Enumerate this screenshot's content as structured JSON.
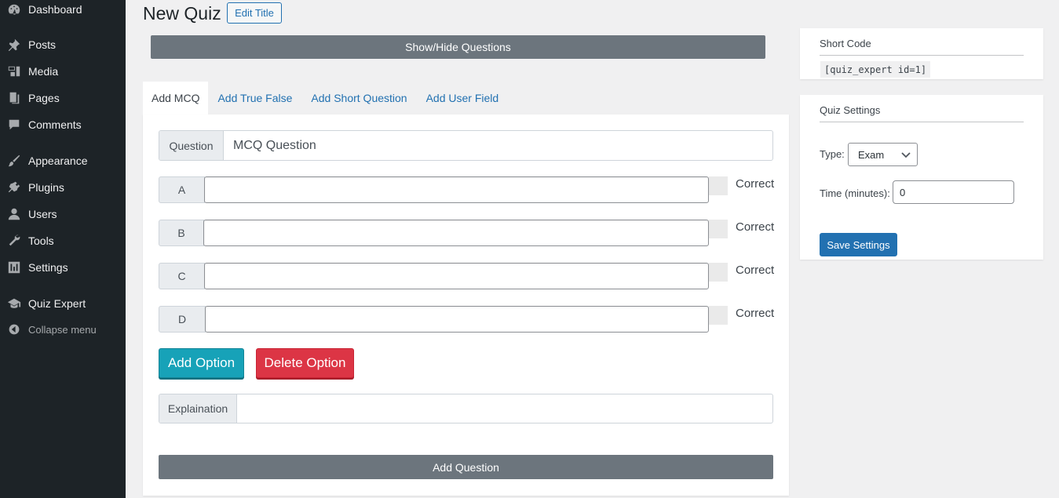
{
  "sidebar": {
    "items": [
      {
        "label": "Dashboard",
        "icon": "dashboard-icon"
      },
      {
        "label": "Posts",
        "icon": "pin-icon"
      },
      {
        "label": "Media",
        "icon": "media-icon"
      },
      {
        "label": "Pages",
        "icon": "pages-icon"
      },
      {
        "label": "Comments",
        "icon": "comment-icon"
      },
      {
        "label": "Appearance",
        "icon": "brush-icon"
      },
      {
        "label": "Plugins",
        "icon": "plugin-icon"
      },
      {
        "label": "Users",
        "icon": "user-icon"
      },
      {
        "label": "Tools",
        "icon": "wrench-icon"
      },
      {
        "label": "Settings",
        "icon": "sliders-icon"
      },
      {
        "label": "Quiz Expert",
        "icon": "graduation-cap-icon"
      }
    ],
    "collapse_label": "Collapse menu"
  },
  "header": {
    "title": "New Quiz",
    "edit_title_label": "Edit Title"
  },
  "show_hide_label": "Show/Hide Questions",
  "tabs": [
    {
      "label": "Add MCQ",
      "active": true
    },
    {
      "label": "Add True False",
      "active": false
    },
    {
      "label": "Add Short Question",
      "active": false
    },
    {
      "label": "Add User Field",
      "active": false
    }
  ],
  "form": {
    "question_label": "Question",
    "question_value": "MCQ Question",
    "options": [
      {
        "letter": "A",
        "value": "",
        "correct_label": "Correct"
      },
      {
        "letter": "B",
        "value": "",
        "correct_label": "Correct"
      },
      {
        "letter": "C",
        "value": "",
        "correct_label": "Correct"
      },
      {
        "letter": "D",
        "value": "",
        "correct_label": "Correct"
      }
    ],
    "add_option_label": "Add Option",
    "delete_option_label": "Delete Option",
    "explanation_label": "Explaination",
    "explanation_value": "",
    "add_question_label": "Add Question"
  },
  "shortcode_box": {
    "title": "Short Code",
    "code": "[quiz_expert id=1]"
  },
  "settings_box": {
    "title": "Quiz Settings",
    "type_label": "Type:",
    "type_value": "Exam",
    "time_label": "Time (minutes):",
    "time_value": "0",
    "save_label": "Save Settings"
  },
  "colors": {
    "sidebar_bg": "#1d2327",
    "link": "#2271b1",
    "add_option": "#17a2b8",
    "delete_option": "#dc3545",
    "secondary_button": "#6c757d"
  }
}
